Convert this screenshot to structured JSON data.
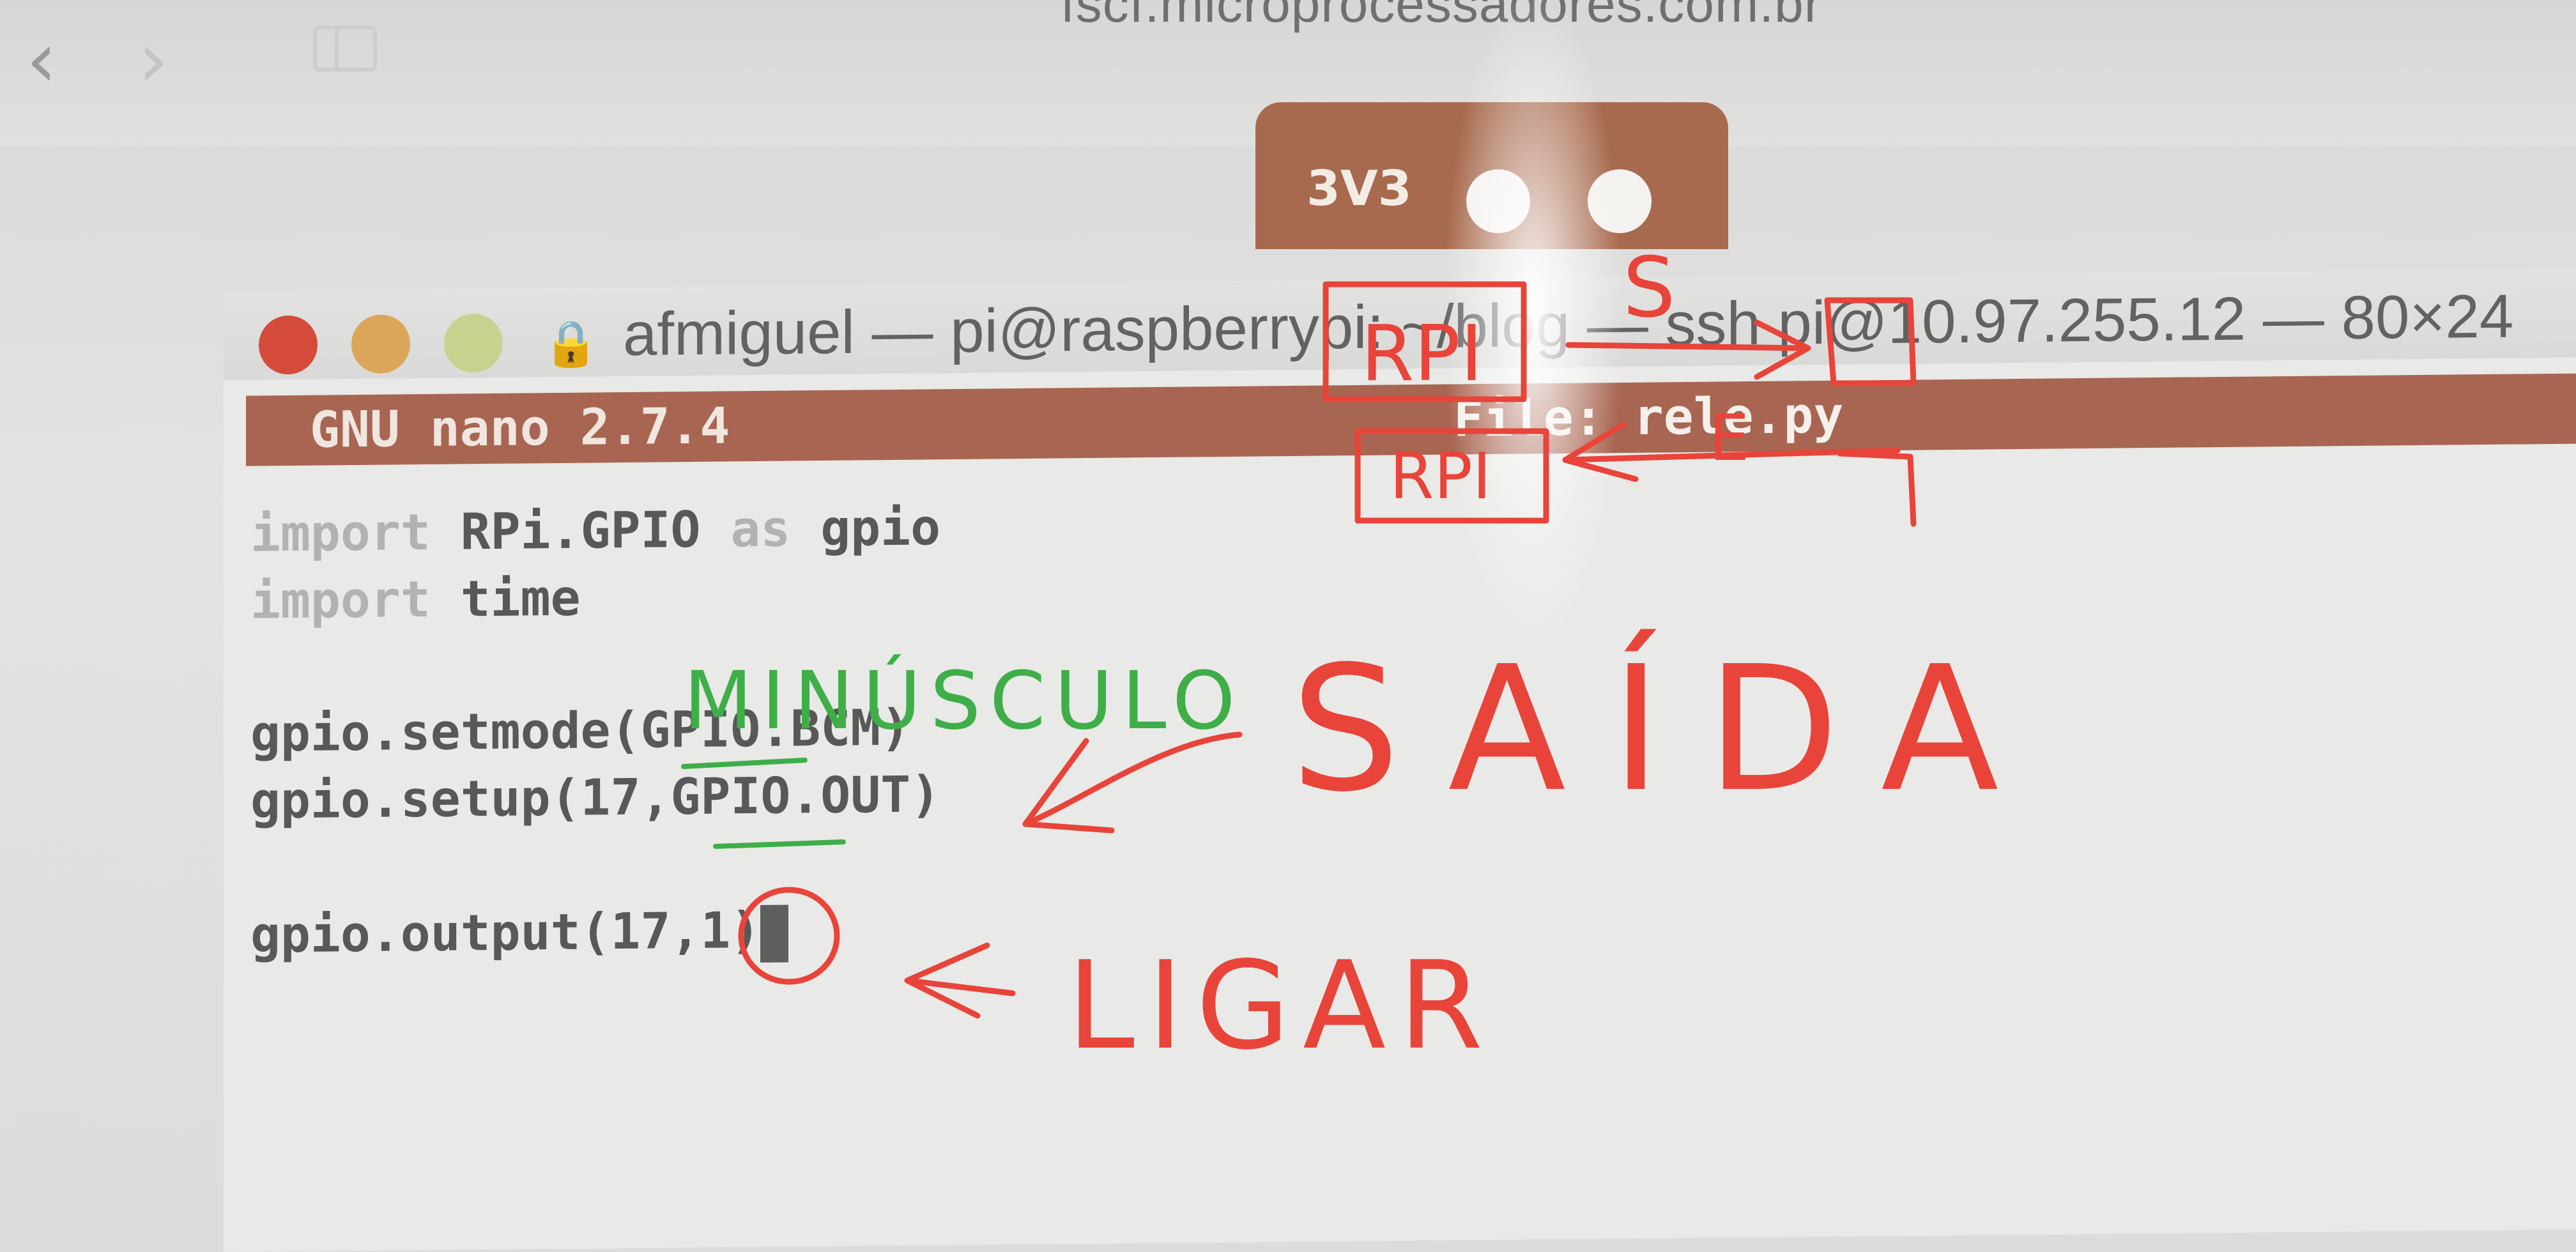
{
  "browser": {
    "back_glyph": "‹",
    "forward_glyph": "›",
    "url": "fscf.microprocessadores.com.br"
  },
  "board": {
    "label": "3V3"
  },
  "terminal": {
    "title": "afmiguel — pi@raspberrypi: ~/blog — ssh pi@10.97.255.12 — 80×24",
    "lock_glyph": "🔒",
    "nano_version": "GNU nano 2.7.4",
    "file_label": "File: rele.py",
    "code": {
      "line1_kw": "import",
      "line1_mid": " RPi.GPIO ",
      "line1_as": "as",
      "line1_end": " gpio",
      "line2_kw": "import",
      "line2_end": " time",
      "line3": "gpio.setmode(GPIO.BCM)",
      "line4": "gpio.setup(17,GPIO.OUT)",
      "line5": "gpio.output(17,1)"
    }
  },
  "annotations": {
    "minusculo": "MINÚSCULO",
    "saida": "SAÍDA",
    "ligar": "LIGAR",
    "rpi_top": "RPI",
    "rpi_bottom": "RPI",
    "s_mark": "S",
    "e_mark": "E",
    "colors": {
      "red": "#e8443a",
      "green": "#3fae49"
    }
  }
}
